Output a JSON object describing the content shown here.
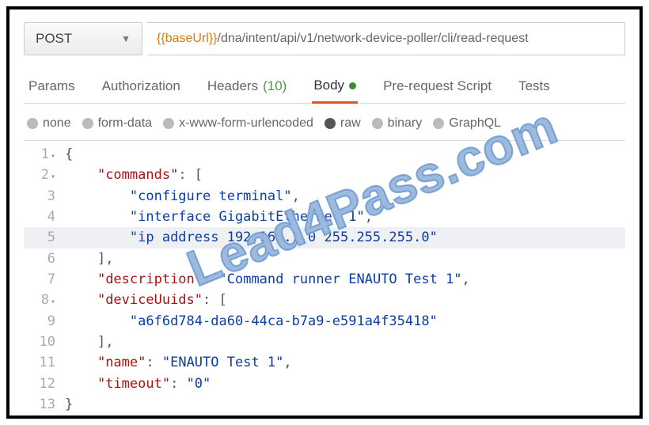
{
  "request": {
    "method": "POST",
    "url_var": "{{baseUrl}}",
    "url_path": "/dna/intent/api/v1/network-device-poller/cli/read-request"
  },
  "tabs": {
    "params": "Params",
    "auth": "Authorization",
    "headers_label": "Headers",
    "headers_count": "(10)",
    "body": "Body",
    "prerequest": "Pre-request Script",
    "tests": "Tests"
  },
  "body_types": {
    "none": "none",
    "form": "form-data",
    "urlenc": "x-www-form-urlencoded",
    "raw": "raw",
    "binary": "binary",
    "graphql": "GraphQL"
  },
  "code": {
    "l1_g": "1",
    "l1_fold": "▾",
    "l1_a": "{",
    "l2_g": "2",
    "l2_fold": "▾",
    "l2_key": "\"commands\"",
    "l2_a": ": [",
    "l3_g": "3",
    "l3_str": "\"configure terminal\"",
    "l3_a": ",",
    "l4_g": "4",
    "l4_str": "\"interface GigabitEthernet 1\"",
    "l4_a": ",",
    "l5_g": "5",
    "l5_str": "\"ip address 192.168.1.0 255.255.255.0\"",
    "l6_g": "6",
    "l6_a": "],",
    "l7_g": "7",
    "l7_key": "\"description\"",
    "l7_b": ": ",
    "l7_str": "\"Command runner ENAUTO Test 1\"",
    "l7_c": ",",
    "l8_g": "8",
    "l8_fold": "▾",
    "l8_key": "\"deviceUuids\"",
    "l8_a": ": [",
    "l9_g": "9",
    "l9_str": "\"a6f6d784-da60-44ca-b7a9-e591a4f35418\"",
    "l10_g": "10",
    "l10_a": "],",
    "l11_g": "11",
    "l11_key": "\"name\"",
    "l11_b": ": ",
    "l11_str": "\"ENAUTO Test 1\"",
    "l11_c": ",",
    "l12_g": "12",
    "l12_key": "\"timeout\"",
    "l12_b": ": ",
    "l12_str": "\"0\"",
    "l13_g": "13",
    "l13_a": "}"
  },
  "watermark": "Lead4Pass.com"
}
